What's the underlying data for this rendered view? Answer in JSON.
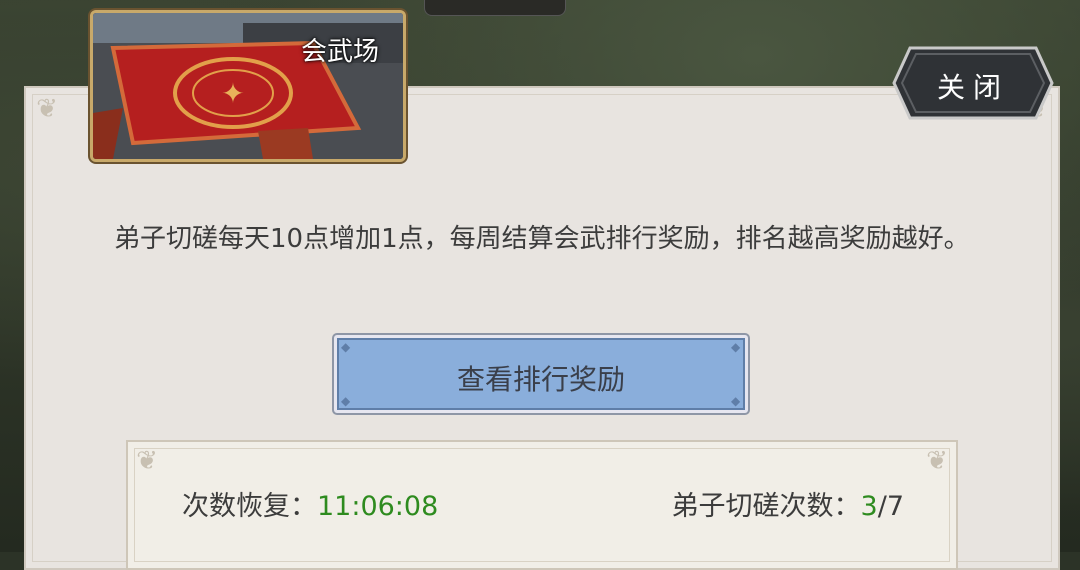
{
  "header": {
    "thumbnail_title": "会武场",
    "close_label": "关闭"
  },
  "description": "弟子切磋每天10点增加1点，每周结算会武排行奖励，排名越高奖励越好。",
  "rank_reward_button": "查看排行奖励",
  "stats": {
    "recovery_label": "次数恢复：",
    "recovery_time": "11:06:08",
    "spar_count_label": "弟子切磋次数：",
    "spar_count_current": "3",
    "spar_count_sep": "/",
    "spar_count_max": "7"
  },
  "colors": {
    "panel_bg": "#e8e4e0",
    "button_blue": "#8aaedb",
    "highlight_green": "#2e8b1f",
    "frame_gold": "#c8a96a"
  }
}
